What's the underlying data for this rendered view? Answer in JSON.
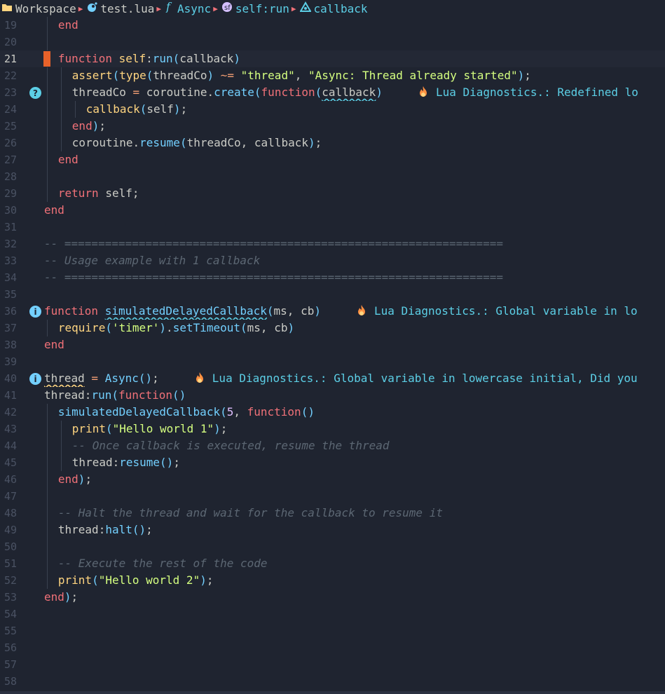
{
  "breadcrumb": [
    {
      "icon": "folder-icon",
      "label": "Workspace",
      "style": "text"
    },
    {
      "icon": "lua-file-icon",
      "label": "test.lua",
      "style": "text"
    },
    {
      "icon": "function-icon",
      "label": "Async",
      "style": "sym"
    },
    {
      "icon": "method-icon",
      "label": "self:run",
      "style": "sym"
    },
    {
      "icon": "variable-icon",
      "label": "callback",
      "style": "sym"
    }
  ],
  "colors": {
    "accent": "#5ccfe6",
    "keyword": "#f07178",
    "string": "#d5ff80",
    "comment": "#5c6773",
    "background": "#1f2430"
  },
  "lines": [
    {
      "n": "19",
      "indent": 1,
      "tokens": [
        [
          "kw",
          "end"
        ]
      ]
    },
    {
      "n": "20",
      "indent": 1,
      "tokens": []
    },
    {
      "n": "21",
      "indent": 1,
      "current": true,
      "cursor": true,
      "tokens": [
        [
          "kw",
          "function "
        ],
        [
          "fnb",
          "self"
        ],
        [
          "pu",
          ":"
        ],
        [
          "fc",
          "run"
        ],
        [
          "par",
          "("
        ],
        [
          "v",
          "callback"
        ],
        [
          "par",
          ")"
        ]
      ]
    },
    {
      "n": "22",
      "indent": 2,
      "tokens": [
        [
          "fn",
          "assert"
        ],
        [
          "par",
          "("
        ],
        [
          "fn",
          "type"
        ],
        [
          "par",
          "("
        ],
        [
          "v",
          "threadCo"
        ],
        [
          "par",
          ")"
        ],
        [
          "op",
          " ~= "
        ],
        [
          "str",
          "\"thread\""
        ],
        [
          "pu",
          ", "
        ],
        [
          "str",
          "\"Async: Thread already started\""
        ],
        [
          "par",
          ")"
        ],
        [
          "pu",
          ";"
        ]
      ]
    },
    {
      "n": "23",
      "indent": 2,
      "sign": "hint",
      "tokens": [
        [
          "v",
          "threadCo"
        ],
        [
          "op",
          " = "
        ],
        [
          "v",
          "coroutine"
        ],
        [
          "pu",
          "."
        ],
        [
          "fc",
          "create"
        ],
        [
          "par",
          "("
        ],
        [
          "kw",
          "function"
        ],
        [
          "par",
          "("
        ],
        [
          "und",
          "callback"
        ],
        [
          "par",
          ")"
        ]
      ],
      "vt": "Lua Diagnostics.: Redefined lo"
    },
    {
      "n": "24",
      "indent": 3,
      "tokens": [
        [
          "fn",
          "callback"
        ],
        [
          "par",
          "("
        ],
        [
          "v",
          "self"
        ],
        [
          "par",
          ")"
        ],
        [
          "pu",
          ";"
        ]
      ]
    },
    {
      "n": "25",
      "indent": 2,
      "tokens": [
        [
          "kw",
          "end"
        ],
        [
          "par",
          ")"
        ],
        [
          "pu",
          ";"
        ]
      ]
    },
    {
      "n": "26",
      "indent": 2,
      "tokens": [
        [
          "v",
          "coroutine"
        ],
        [
          "pu",
          "."
        ],
        [
          "fc",
          "resume"
        ],
        [
          "par",
          "("
        ],
        [
          "v",
          "threadCo"
        ],
        [
          "pu",
          ", "
        ],
        [
          "v",
          "callback"
        ],
        [
          "par",
          ")"
        ],
        [
          "pu",
          ";"
        ]
      ]
    },
    {
      "n": "27",
      "indent": 1,
      "tokens": [
        [
          "kw",
          "end"
        ]
      ]
    },
    {
      "n": "28",
      "indent": 1,
      "tokens": []
    },
    {
      "n": "29",
      "indent": 1,
      "tokens": [
        [
          "kw",
          "return "
        ],
        [
          "v",
          "self"
        ],
        [
          "pu",
          ";"
        ]
      ]
    },
    {
      "n": "30",
      "indent": 0,
      "tokens": [
        [
          "kw",
          "end"
        ]
      ]
    },
    {
      "n": "31",
      "indent": 0,
      "tokens": []
    },
    {
      "n": "32",
      "indent": 0,
      "tokens": [
        [
          "cmt",
          "-- ================================================================="
        ]
      ]
    },
    {
      "n": "33",
      "indent": 0,
      "tokens": [
        [
          "cmt",
          "-- Usage example with 1 callback"
        ]
      ]
    },
    {
      "n": "34",
      "indent": 0,
      "tokens": [
        [
          "cmt",
          "-- ================================================================="
        ]
      ]
    },
    {
      "n": "35",
      "indent": 0,
      "tokens": []
    },
    {
      "n": "36",
      "indent": 0,
      "sign": "info",
      "tokens": [
        [
          "kw",
          "function "
        ],
        [
          "undfn",
          "simulatedDelayedCallback"
        ],
        [
          "par",
          "("
        ],
        [
          "v",
          "ms"
        ],
        [
          "pu",
          ", "
        ],
        [
          "v",
          "cb"
        ],
        [
          "par",
          ")"
        ]
      ],
      "vt": "Lua Diagnostics.: Global variable in lo"
    },
    {
      "n": "37",
      "indent": 1,
      "tokens": [
        [
          "fn",
          "require"
        ],
        [
          "par",
          "("
        ],
        [
          "str",
          "'timer'"
        ],
        [
          "par",
          ")"
        ],
        [
          "pu",
          "."
        ],
        [
          "fc",
          "setTimeout"
        ],
        [
          "par",
          "("
        ],
        [
          "v",
          "ms"
        ],
        [
          "pu",
          ", "
        ],
        [
          "v",
          "cb"
        ],
        [
          "par",
          ")"
        ]
      ]
    },
    {
      "n": "38",
      "indent": 0,
      "tokens": [
        [
          "kw",
          "end"
        ]
      ]
    },
    {
      "n": "39",
      "indent": 0,
      "tokens": []
    },
    {
      "n": "40",
      "indent": 0,
      "sign": "info",
      "tokens": [
        [
          "undy",
          "thread"
        ],
        [
          "op",
          " = "
        ],
        [
          "fc",
          "Async"
        ],
        [
          "par",
          "("
        ],
        [
          "par",
          ")"
        ],
        [
          "pu",
          ";"
        ]
      ],
      "vt": "Lua Diagnostics.: Global variable in lowercase initial, Did you"
    },
    {
      "n": "41",
      "indent": 0,
      "tokens": [
        [
          "v",
          "thread"
        ],
        [
          "pu",
          ":"
        ],
        [
          "fc",
          "run"
        ],
        [
          "par",
          "("
        ],
        [
          "kw",
          "function"
        ],
        [
          "par",
          "("
        ],
        [
          "par",
          ")"
        ]
      ]
    },
    {
      "n": "42",
      "indent": 1,
      "tokens": [
        [
          "fc",
          "simulatedDelayedCallback"
        ],
        [
          "par",
          "("
        ],
        [
          "num",
          "5"
        ],
        [
          "pu",
          ", "
        ],
        [
          "kw",
          "function"
        ],
        [
          "par",
          "("
        ],
        [
          "par",
          ")"
        ]
      ]
    },
    {
      "n": "43",
      "indent": 2,
      "tokens": [
        [
          "fn",
          "print"
        ],
        [
          "par",
          "("
        ],
        [
          "str",
          "\"Hello world 1\""
        ],
        [
          "par",
          ")"
        ],
        [
          "pu",
          ";"
        ]
      ]
    },
    {
      "n": "44",
      "indent": 2,
      "tokens": [
        [
          "cmt",
          "-- Once callback is executed, resume the thread"
        ]
      ]
    },
    {
      "n": "45",
      "indent": 2,
      "tokens": [
        [
          "v",
          "thread"
        ],
        [
          "pu",
          ":"
        ],
        [
          "fc",
          "resume"
        ],
        [
          "par",
          "("
        ],
        [
          "par",
          ")"
        ],
        [
          "pu",
          ";"
        ]
      ]
    },
    {
      "n": "46",
      "indent": 1,
      "tokens": [
        [
          "kw",
          "end"
        ],
        [
          "par",
          ")"
        ],
        [
          "pu",
          ";"
        ]
      ]
    },
    {
      "n": "47",
      "indent": 1,
      "tokens": []
    },
    {
      "n": "48",
      "indent": 1,
      "tokens": [
        [
          "cmt",
          "-- Halt the thread and wait for the callback to resume it"
        ]
      ]
    },
    {
      "n": "49",
      "indent": 1,
      "tokens": [
        [
          "v",
          "thread"
        ],
        [
          "pu",
          ":"
        ],
        [
          "fc",
          "halt"
        ],
        [
          "par",
          "("
        ],
        [
          "par",
          ")"
        ],
        [
          "pu",
          ";"
        ]
      ]
    },
    {
      "n": "50",
      "indent": 1,
      "tokens": []
    },
    {
      "n": "51",
      "indent": 1,
      "tokens": [
        [
          "cmt",
          "-- Execute the rest of the code"
        ]
      ]
    },
    {
      "n": "52",
      "indent": 1,
      "tokens": [
        [
          "fn",
          "print"
        ],
        [
          "par",
          "("
        ],
        [
          "str",
          "\"Hello world 2\""
        ],
        [
          "par",
          ")"
        ],
        [
          "pu",
          ";"
        ]
      ]
    },
    {
      "n": "53",
      "indent": 0,
      "tokens": [
        [
          "kw",
          "end"
        ],
        [
          "par",
          ")"
        ],
        [
          "pu",
          ";"
        ]
      ]
    },
    {
      "n": "54",
      "indent": 0,
      "tokens": []
    },
    {
      "n": "55",
      "indent": 0,
      "tokens": []
    },
    {
      "n": "56",
      "indent": 0,
      "tokens": []
    },
    {
      "n": "57",
      "indent": 0,
      "tokens": []
    },
    {
      "n": "58",
      "indent": 0,
      "tokens": []
    }
  ]
}
